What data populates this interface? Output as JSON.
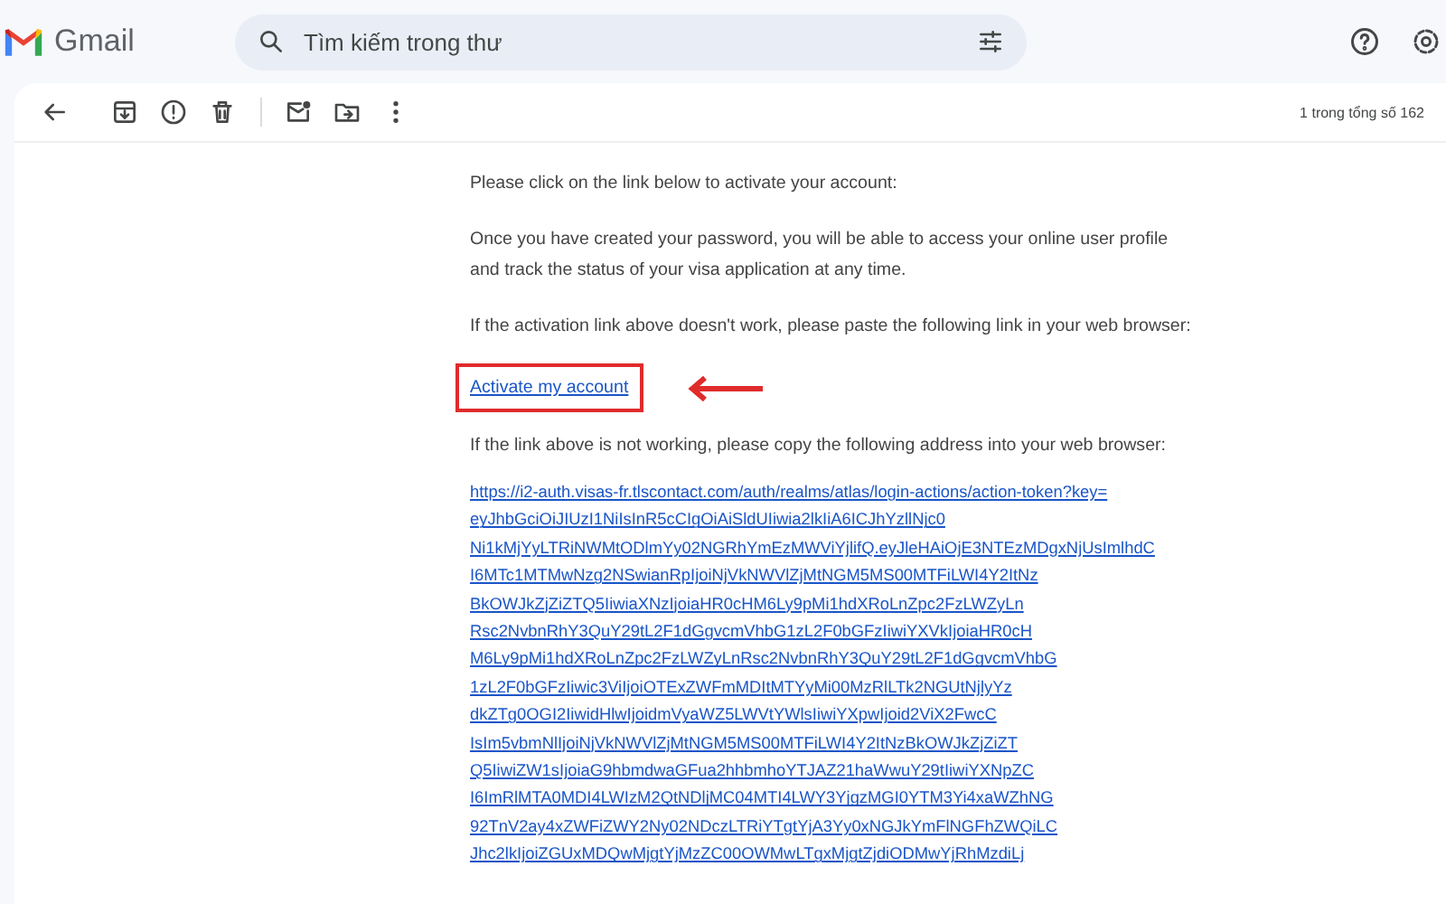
{
  "app": {
    "name": "Gmail"
  },
  "search": {
    "placeholder": "Tìm kiếm trong thư"
  },
  "toolbar": {
    "counter": "1 trong tổng số 162"
  },
  "email": {
    "intro": "Please click on the link below to activate your account:",
    "info": "Once you have created your password, you will be able to access your online user profile and track the status of your visa application at any time.",
    "fallback_intro": "If the activation link above doesn't work, please paste the following link in your web browser:",
    "activation_link": "Activate my account",
    "copy_intro": "If the link above is not working, please copy the following address into your web browser:",
    "url_lines": [
      "https://i2-auth.visas-fr.tlscontact.com/auth/realms/atlas/login-actions/action-token?key=",
      "eyJhbGciOiJIUzI1NiIsInR5cCIgOiAiSldUIiwia2lkIiA6ICJhYzllNjc0",
      "Ni1kMjYyLTRiNWMtODlmYy02NGRhYmEzMWViYjlifQ.eyJleHAiOjE3NTEzMDgxNjUsImlhdC",
      "I6MTc1MTMwNzg2NSwianRpIjoiNjVkNWVlZjMtNGM5MS00MTFiLWI4Y2ItNz",
      "BkOWJkZjZiZTQ5IiwiaXNzIjoiaHR0cHM6Ly9pMi1hdXRoLnZpc2FzLWZyLn",
      "Rsc2NvbnRhY3QuY29tL2F1dGgvcmVhbG1zL2F0bGFzIiwiYXVkIjoiaHR0cH",
      "M6Ly9pMi1hdXRoLnZpc2FzLWZyLnRsc2NvbnRhY3QuY29tL2F1dGgvcmVhbG",
      "1zL2F0bGFzIiwic3ViIjoiOTExZWFmMDItMTYyMi00MzRlLTk2NGUtNjlyYz",
      "dkZTg0OGI2IiwidHlwIjoidmVyaWZ5LWVtYWlsIiwiYXpwIjoid2ViX2FwcC",
      "IsIm5vbmNlIjoiNjVkNWVlZjMtNGM5MS00MTFiLWI4Y2ItNzBkOWJkZjZiZT",
      "Q5IiwiZW1sIjoiaG9hbmdwaGFua2hhbmhoYTJAZ21haWwuY29tIiwiYXNpZC",
      "I6ImRlMTA0MDI4LWIzM2QtNDljMC04MTI4LWY3YjgzMGI0YTM3Yi4xaWZhNG",
      "92TnV2ay4xZWFiZWY2Ny02NDczLTRiYTgtYjA3Yy0xNGJkYmFlNGFhZWQiLC",
      "Jhc2lkIjoiZGUxMDQwMjgtYjMzZC00OWMwLTgxMjgtZjdiODMwYjRhMzdiLj"
    ]
  }
}
